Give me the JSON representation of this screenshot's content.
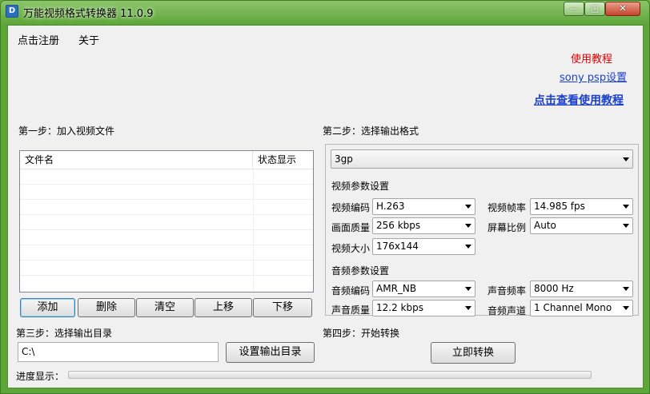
{
  "window": {
    "title": "万能视频格式转换器 11.0.9",
    "icon_name": "app-icon",
    "controls": {
      "minimize": "minimize-icon",
      "maximize": "maximize-icon",
      "close": "close-icon"
    }
  },
  "menu": {
    "items": [
      {
        "label": "点击注册"
      },
      {
        "label": "关于"
      }
    ]
  },
  "links": {
    "tutorial": "使用教程",
    "sony_psp": "sony psp设置",
    "view_tutorial": "点击查看使用教程",
    "tutorial_color": "#e00000",
    "link_color": "#1a3fcf"
  },
  "step1": {
    "label": "第一步：加入视频文件",
    "columns": [
      "文件名",
      "状态显示"
    ],
    "buttons": [
      "添加",
      "删除",
      "清空",
      "上移",
      "下移"
    ]
  },
  "step2": {
    "label": "第二步：选择输出格式",
    "format": "3gp",
    "video_section": "视频参数设置",
    "video": {
      "codec_label": "视频编码",
      "codec": "H.263",
      "framerate_label": "视频帧率",
      "framerate": "14.985 fps",
      "quality_label": "画面质量",
      "quality": "256 kbps",
      "aspect_label": "屏幕比例",
      "aspect": "Auto",
      "size_label": "视频大小",
      "size": "176x144"
    },
    "audio_section": "音频参数设置",
    "audio": {
      "codec_label": "音频编码",
      "codec": "AMR_NB",
      "samplerate_label": "声音频率",
      "samplerate": "8000 Hz",
      "quality_label": "声音质量",
      "quality": "12.2 kbps",
      "channel_label": "音频声道",
      "channel": "1 Channel Mono"
    }
  },
  "step3": {
    "label": "第三步：选择输出目录",
    "path": "C:\\",
    "button": "设置输出目录"
  },
  "step4": {
    "label": "第四步：开始转换",
    "button": "立即转换"
  },
  "progress": {
    "label": "进度显示：",
    "value": 0
  }
}
